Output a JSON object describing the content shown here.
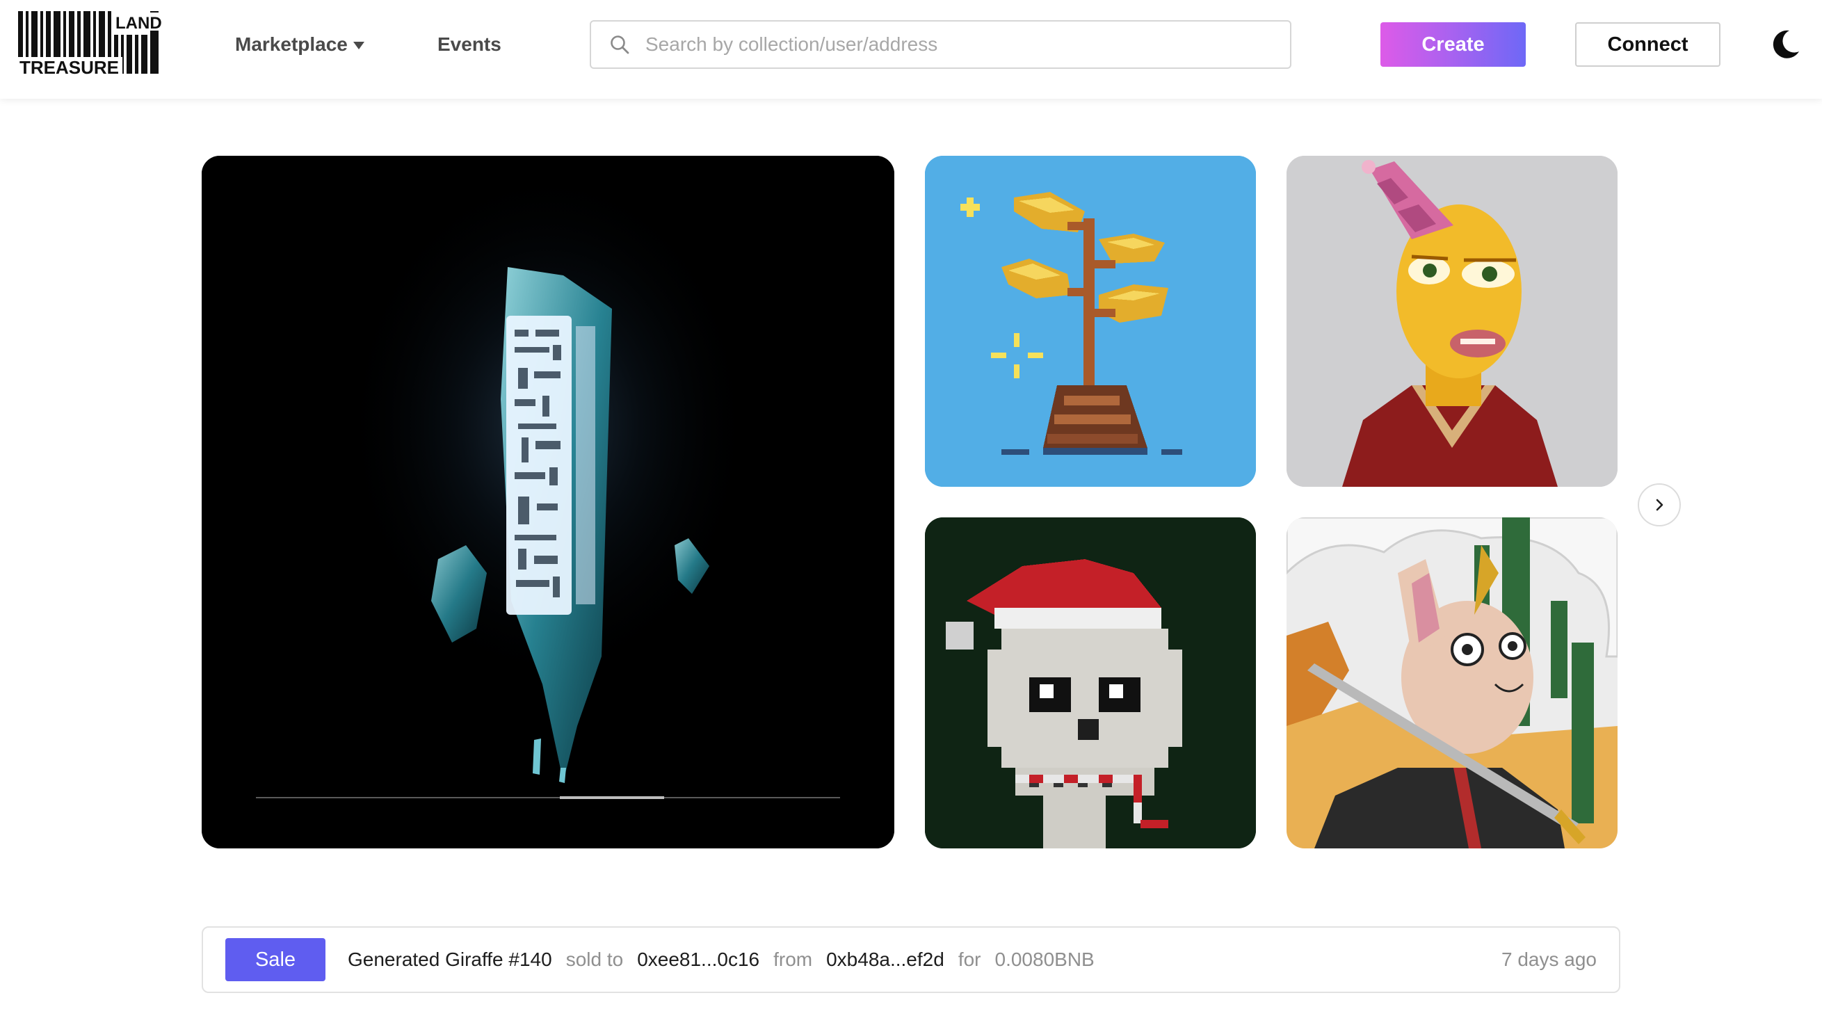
{
  "header": {
    "logo_text_top": "LAND",
    "logo_text_bottom": "TREASURE",
    "nav": {
      "marketplace_label": "Marketplace",
      "events_label": "Events"
    },
    "search": {
      "placeholder": "Search by collection/user/address",
      "value": ""
    },
    "create_label": "Create",
    "connect_label": "Connect",
    "theme_icon": "moon-icon"
  },
  "gallery": {
    "items": [
      {
        "name": "crystal-monolith-artwork",
        "bg": "#000000"
      },
      {
        "name": "pixel-golden-plant-artwork",
        "bg": "#52aee6"
      },
      {
        "name": "party-hat-frog-artwork",
        "bg": "#cfcfd1"
      },
      {
        "name": "santa-pixel-skull-artwork",
        "bg": "#0f2414"
      },
      {
        "name": "sphynx-cat-sword-artwork",
        "bg": "#ececec"
      }
    ],
    "next_icon": "chevron-right-icon"
  },
  "activity": {
    "badge": "Sale",
    "item": "Generated Giraffe #140",
    "sold_to_label": "sold to",
    "buyer": "0xee81...0c16",
    "from_label": "from",
    "seller": "0xb48a...ef2d",
    "for_label": "for",
    "price": "0.0080BNB",
    "time": "7 days ago"
  },
  "colors": {
    "create_gradient_start": "#dd5be8",
    "create_gradient_end": "#6e68f6",
    "sale_badge": "#5f5df0"
  }
}
